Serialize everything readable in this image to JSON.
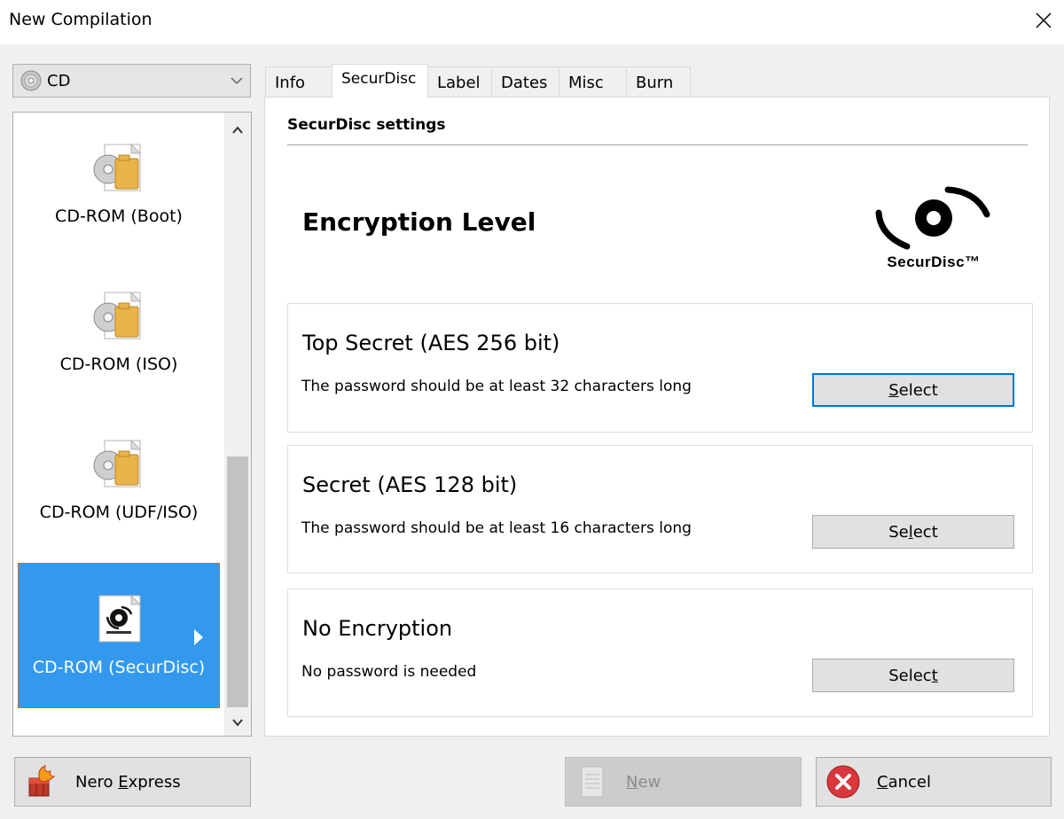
{
  "window": {
    "title": "New Compilation"
  },
  "disc_selector": {
    "value": "CD"
  },
  "compilation_list": [
    {
      "label": "CD-ROM (Boot)",
      "icon": "disc-folder-icon"
    },
    {
      "label": "CD-ROM (ISO)",
      "icon": "disc-folder-icon"
    },
    {
      "label": "CD-ROM (UDF/ISO)",
      "icon": "disc-folder-icon"
    },
    {
      "label": "CD-ROM (SecurDisc)",
      "icon": "securdisc-file-icon",
      "selected": true
    }
  ],
  "tabs": [
    {
      "label": "Info"
    },
    {
      "label": "SecurDisc",
      "active": true
    },
    {
      "label": "Label"
    },
    {
      "label": "Dates"
    },
    {
      "label": "Misc"
    },
    {
      "label": "Burn"
    }
  ],
  "panel": {
    "section_title": "SecurDisc settings",
    "heading": "Encryption Level",
    "logo_text": "SecurDisc™",
    "options": [
      {
        "title": "Top Secret (AES 256 bit)",
        "description": "The password should be at least 32 characters long",
        "button_pre": "",
        "button_key": "S",
        "button_post": "elect"
      },
      {
        "title": "Secret (AES 128 bit)",
        "description": "The password should be at least 16 characters long",
        "button_pre": "Se",
        "button_key": "l",
        "button_post": "ect"
      },
      {
        "title": "No Encryption",
        "description": "No password is needed",
        "button_pre": "Selec",
        "button_key": "t",
        "button_post": ""
      }
    ]
  },
  "footer": {
    "nero_pre": "Nero ",
    "nero_key": "E",
    "nero_post": "xpress",
    "new_key": "N",
    "new_post": "ew",
    "cancel_key": "C",
    "cancel_post": "ancel"
  },
  "colors": {
    "accent": "#0078d7",
    "selection": "#3399ee",
    "selection_border": "#c26f2a"
  }
}
